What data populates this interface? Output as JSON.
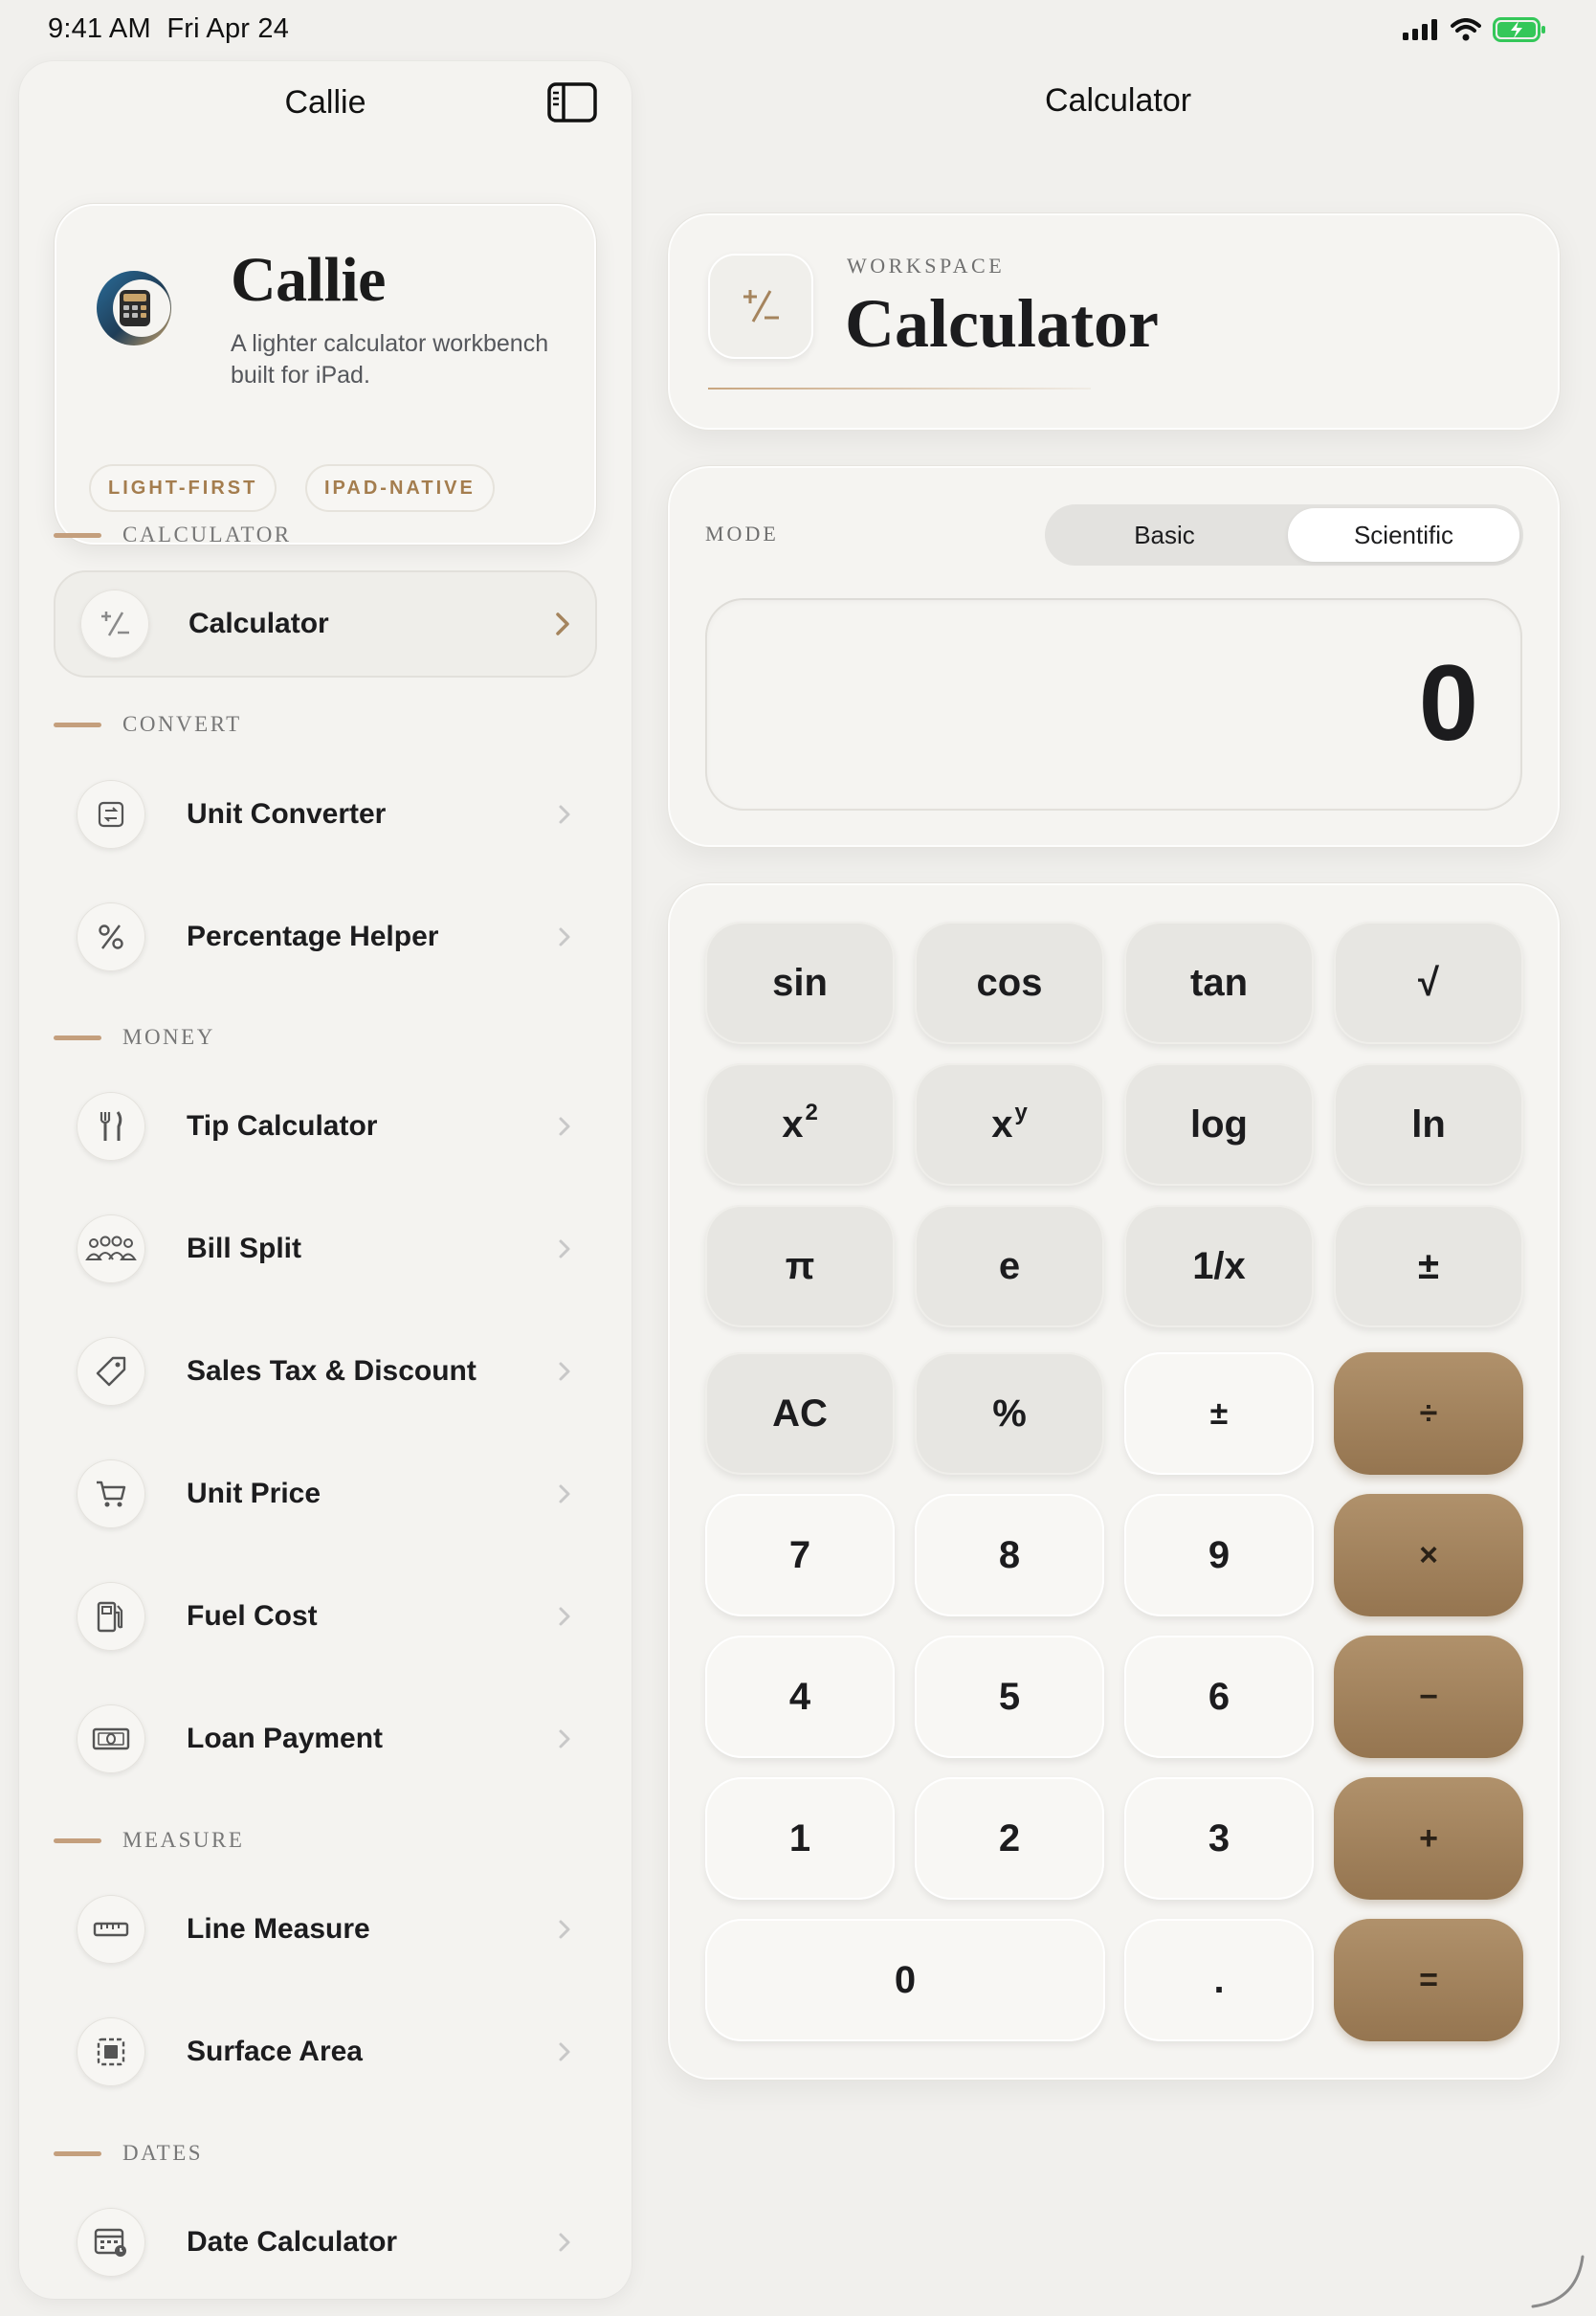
{
  "status": {
    "time": "9:41 AM",
    "date": "Fri Apr 24"
  },
  "sidebar": {
    "title": "Callie",
    "brand": {
      "name": "Callie",
      "description": "A lighter calculator workbench built for iPad.",
      "tags": [
        "LIGHT-FIRST",
        "IPAD-NATIVE"
      ]
    },
    "sections": [
      {
        "label": "CALCULATOR",
        "items": [
          {
            "label": "Calculator",
            "icon": "plus-minus-icon",
            "active": true
          }
        ]
      },
      {
        "label": "CONVERT",
        "items": [
          {
            "label": "Unit Converter",
            "icon": "convert-icon"
          },
          {
            "label": "Percentage Helper",
            "icon": "percent-icon"
          }
        ]
      },
      {
        "label": "MONEY",
        "items": [
          {
            "label": "Tip Calculator",
            "icon": "fork-knife-icon"
          },
          {
            "label": "Bill Split",
            "icon": "people-icon"
          },
          {
            "label": "Sales Tax & Discount",
            "icon": "tag-icon"
          },
          {
            "label": "Unit Price",
            "icon": "cart-icon"
          },
          {
            "label": "Fuel Cost",
            "icon": "fuel-pump-icon"
          },
          {
            "label": "Loan Payment",
            "icon": "banknote-icon"
          }
        ]
      },
      {
        "label": "MEASURE",
        "items": [
          {
            "label": "Line Measure",
            "icon": "ruler-icon"
          },
          {
            "label": "Surface Area",
            "icon": "area-icon"
          }
        ]
      },
      {
        "label": "DATES",
        "items": [
          {
            "label": "Date Calculator",
            "icon": "calendar-icon"
          }
        ]
      }
    ]
  },
  "main": {
    "title": "Calculator",
    "workspace": {
      "kicker": "WORKSPACE",
      "title": "Calculator"
    },
    "mode": {
      "label": "MODE",
      "options": [
        "Basic",
        "Scientific"
      ],
      "selected": "Scientific"
    },
    "display": {
      "value": "0"
    },
    "keys": {
      "r1": [
        "sin",
        "cos",
        "tan",
        "√"
      ],
      "r2": [
        "x",
        "x",
        "log",
        "ln"
      ],
      "r2_sup": [
        "2",
        "y"
      ],
      "r3": [
        "π",
        "e",
        "1/x",
        "±"
      ],
      "r4": [
        "AC",
        "%",
        "±",
        "÷"
      ],
      "r5": [
        "7",
        "8",
        "9",
        "×"
      ],
      "r6": [
        "4",
        "5",
        "6",
        "−"
      ],
      "r7": [
        "1",
        "2",
        "3",
        "+"
      ],
      "r8": [
        "0",
        ".",
        "="
      ]
    }
  },
  "colors": {
    "accent": "#a5845d",
    "accent_dark": "#957550",
    "background": "#f1f0ed"
  }
}
